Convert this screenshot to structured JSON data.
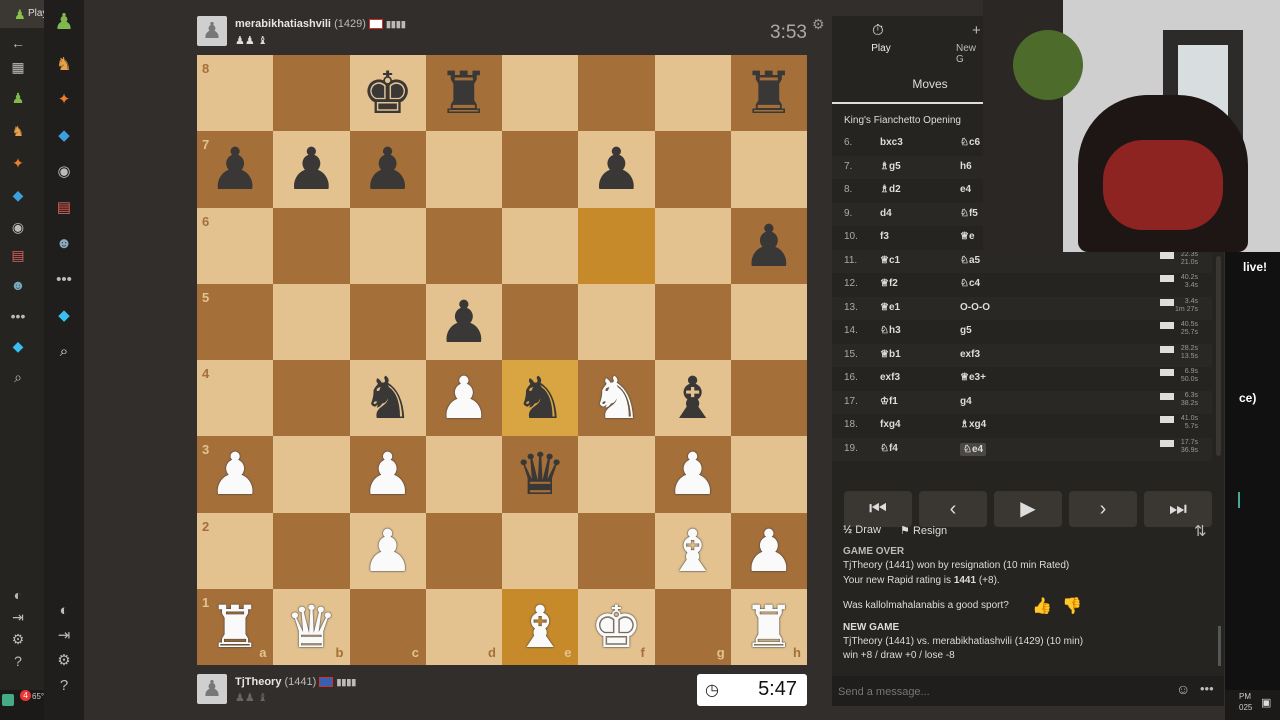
{
  "browser": {
    "tab_label": "Play"
  },
  "top_player": {
    "name": "merabikhatiashvili",
    "rating": "(1429)",
    "clock": "3:53"
  },
  "bottom_player": {
    "name": "TjTheory",
    "rating": "(1441)",
    "clock": "5:47"
  },
  "board": {
    "ranks": [
      "8",
      "7",
      "6",
      "5",
      "4",
      "3",
      "2",
      "1"
    ],
    "files": [
      "a",
      "b",
      "c",
      "d",
      "e",
      "f",
      "g",
      "h"
    ],
    "highlight_squares": [
      "f6",
      "e4",
      "e1"
    ],
    "pieces": [
      {
        "sq": "c8",
        "glyph": "♚",
        "color": "b"
      },
      {
        "sq": "d8",
        "glyph": "♜",
        "color": "b"
      },
      {
        "sq": "h8",
        "glyph": "♜",
        "color": "b"
      },
      {
        "sq": "a7",
        "glyph": "♟",
        "color": "b"
      },
      {
        "sq": "b7",
        "glyph": "♟",
        "color": "b"
      },
      {
        "sq": "c7",
        "glyph": "♟",
        "color": "b"
      },
      {
        "sq": "f7",
        "glyph": "♟",
        "color": "b"
      },
      {
        "sq": "h6",
        "glyph": "♟",
        "color": "b"
      },
      {
        "sq": "d5",
        "glyph": "♟",
        "color": "b"
      },
      {
        "sq": "c4",
        "glyph": "♞",
        "color": "b"
      },
      {
        "sq": "d4",
        "glyph": "♟",
        "color": "w"
      },
      {
        "sq": "e4",
        "glyph": "♞",
        "color": "b"
      },
      {
        "sq": "f4",
        "glyph": "♞",
        "color": "w"
      },
      {
        "sq": "g4",
        "glyph": "♝",
        "color": "b"
      },
      {
        "sq": "a3",
        "glyph": "♟",
        "color": "w"
      },
      {
        "sq": "c3",
        "glyph": "♟",
        "color": "w"
      },
      {
        "sq": "e3",
        "glyph": "♛",
        "color": "b"
      },
      {
        "sq": "g3",
        "glyph": "♟",
        "color": "w"
      },
      {
        "sq": "c2",
        "glyph": "♟",
        "color": "w"
      },
      {
        "sq": "g2",
        "glyph": "♝",
        "color": "w"
      },
      {
        "sq": "h2",
        "glyph": "♟",
        "color": "w"
      },
      {
        "sq": "a1",
        "glyph": "♜",
        "color": "w"
      },
      {
        "sq": "b1",
        "glyph": "♛",
        "color": "w"
      },
      {
        "sq": "e1",
        "glyph": "♝",
        "color": "w"
      },
      {
        "sq": "f1",
        "glyph": "♚",
        "color": "w"
      },
      {
        "sq": "h1",
        "glyph": "♜",
        "color": "w"
      }
    ]
  },
  "panel": {
    "tab_play": "Play",
    "tab_new_game": "New G",
    "moves_tab": "Moves",
    "opening": "King's Fianchetto Opening",
    "moves": [
      {
        "num": "6.",
        "w": "bxc3",
        "b": "♘c6",
        "tw": "",
        "tb": ""
      },
      {
        "num": "7.",
        "w": "♗g5",
        "b": "h6",
        "tw": "",
        "tb": ""
      },
      {
        "num": "8.",
        "w": "♗d2",
        "b": "e4",
        "tw": "",
        "tb": ""
      },
      {
        "num": "9.",
        "w": "d4",
        "b": "♘f5",
        "tw": "",
        "tb": ""
      },
      {
        "num": "10.",
        "w": "f3",
        "b": "♕e",
        "tw": "",
        "tb": ""
      },
      {
        "num": "11.",
        "w": "♕c1",
        "b": "♘a5",
        "tw": "22.3s",
        "tb": "21.0s"
      },
      {
        "num": "12.",
        "w": "♕f2",
        "b": "♘c4",
        "tw": "40.2s",
        "tb": "3.4s"
      },
      {
        "num": "13.",
        "w": "♕e1",
        "b": "O-O-O",
        "tw": "3.4s",
        "tb": "1m 27s"
      },
      {
        "num": "14.",
        "w": "♘h3",
        "b": "g5",
        "tw": "40.5s",
        "tb": "25.7s"
      },
      {
        "num": "15.",
        "w": "♕b1",
        "b": "exf3",
        "tw": "28.2s",
        "tb": "13.5s"
      },
      {
        "num": "16.",
        "w": "exf3",
        "b": "♕e3+",
        "tw": "6.9s",
        "tb": "50.0s"
      },
      {
        "num": "17.",
        "w": "♔f1",
        "b": "g4",
        "tw": "6.3s",
        "tb": "38.2s"
      },
      {
        "num": "18.",
        "w": "fxg4",
        "b": "♗xg4",
        "tw": "41.0s",
        "tb": "5.7s"
      },
      {
        "num": "19.",
        "w": "♘f4",
        "b": "♘e4",
        "tw": "17.7s",
        "tb": "36.9s"
      }
    ],
    "draw_label": "Draw",
    "draw_icon": "½",
    "resign_label": "Resign",
    "chat": {
      "game_over": "GAME OVER",
      "result": "TjTheory (1441) won by resignation (10 min Rated)",
      "rating_prefix": "Your new Rapid rating is ",
      "rating_value": "1441",
      "rating_change": " (+8).",
      "sport_question": "Was kallolmahalanabis a good sport?",
      "new_game": "NEW GAME",
      "new_game_desc": "TjTheory (1441) vs. merabikhatiashvili (1429) (10 min)",
      "win_draw_lose": "win +8 / draw +0 / lose -8",
      "input_placeholder": "Send a message..."
    }
  },
  "overlay": {
    "live_text": "live!",
    "ce_text": "ce)"
  },
  "taskbar": {
    "weather": "65°",
    "time_fragment": "PM",
    "date_fragment": "025",
    "notif_count": "4"
  }
}
